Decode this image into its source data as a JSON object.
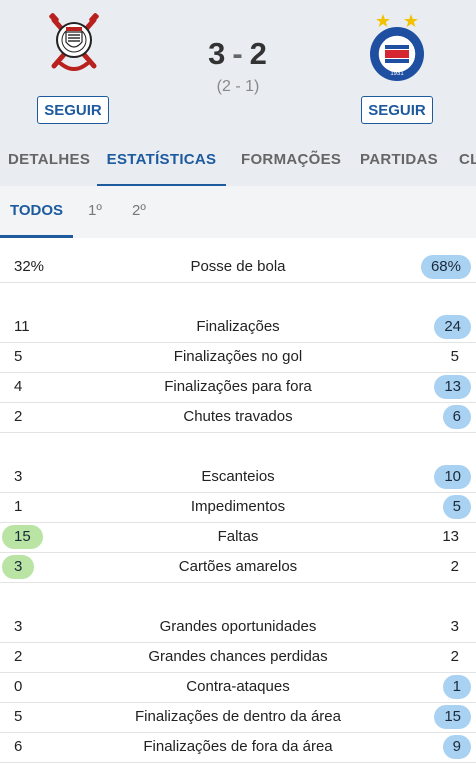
{
  "match": {
    "score_home": "3",
    "score_away": "2",
    "score_sep": "-",
    "halftime": "(2 - 1)",
    "follow_home": "SEGUIR",
    "follow_away": "SEGUIR",
    "away_crest_year": "1931",
    "away_crest_text": "ESPORTE CLUBE BAHIA"
  },
  "tabs": [
    "DETALHES",
    "ESTATÍSTICAS",
    "FORMAÇÕES",
    "PARTIDAS",
    "CL"
  ],
  "subtabs": [
    "TODOS",
    "1º",
    "2º"
  ],
  "stats": [
    {
      "label": "Posse de bola",
      "home": "32%",
      "away": "68%"
    },
    {
      "label": "Finalizações",
      "home": "11",
      "away": "24"
    },
    {
      "label": "Finalizações no gol",
      "home": "5",
      "away": "5"
    },
    {
      "label": "Finalizações para fora",
      "home": "4",
      "away": "13"
    },
    {
      "label": "Chutes travados",
      "home": "2",
      "away": "6"
    },
    {
      "label": "Escanteios",
      "home": "3",
      "away": "10"
    },
    {
      "label": "Impedimentos",
      "home": "1",
      "away": "5"
    },
    {
      "label": "Faltas",
      "home": "15",
      "away": "13"
    },
    {
      "label": "Cartões amarelos",
      "home": "3",
      "away": "2"
    },
    {
      "label": "Grandes oportunidades",
      "home": "3",
      "away": "3"
    },
    {
      "label": "Grandes chances perdidas",
      "home": "2",
      "away": "2"
    },
    {
      "label": "Contra-ataques",
      "home": "0",
      "away": "1"
    },
    {
      "label": "Finalizações de dentro da área",
      "home": "5",
      "away": "15"
    },
    {
      "label": "Finalizações de fora da área",
      "home": "6",
      "away": "9"
    }
  ],
  "colors": {
    "accent": "#1d5a9e",
    "pill_blue": "#a9d1f2",
    "pill_green": "#b9e4a4"
  }
}
